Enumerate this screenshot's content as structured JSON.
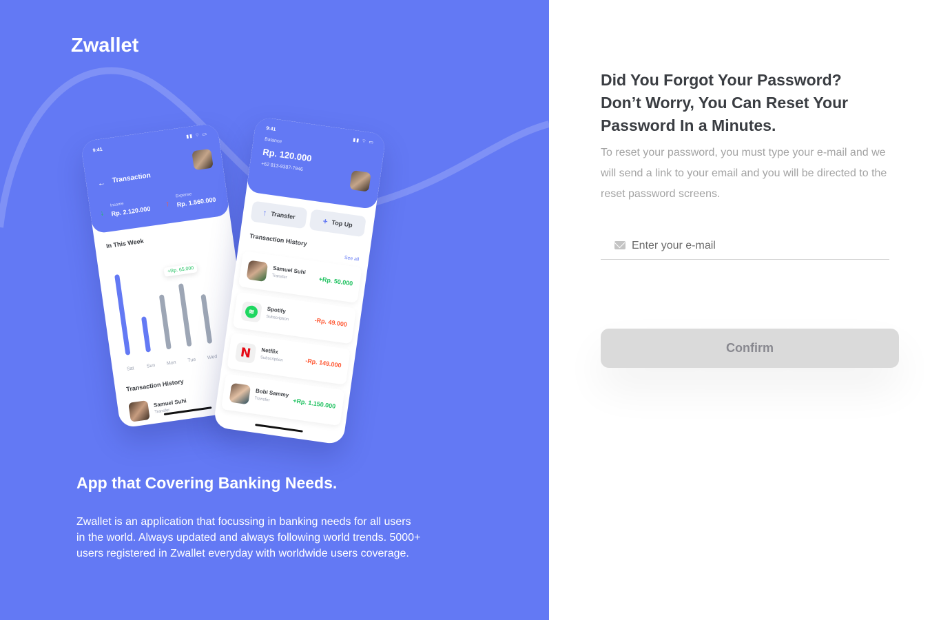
{
  "brand": "Zwallet",
  "colors": {
    "primary": "#6379f4",
    "income": "#1ec15f",
    "expense": "#ff5b37",
    "button_disabled": "#dadada"
  },
  "promo": {
    "tagline": "App that Covering Banking Needs.",
    "description": "Zwallet is an application that focussing in banking needs for all users in the world. Always updated and always following world trends. 5000+ users registered in Zwallet everyday with worldwide users coverage."
  },
  "phone_left": {
    "time": "9:41",
    "status_icons": "▮▮ ⌔ ▭",
    "title": "Transaction",
    "income_label": "Income",
    "income_value": "Rp. 2.120.000",
    "expense_label": "Expense",
    "expense_value": "Rp. 1.560.000",
    "week_title": "In This Week",
    "tooltip": "+Rp. 65.000",
    "days": [
      "Sat",
      "Sun",
      "Mon",
      "Tue",
      "Wed"
    ],
    "history_title": "Transaction History",
    "row_name": "Samuel Suhi",
    "row_sub": "Transfer"
  },
  "phone_right": {
    "time": "9:41",
    "status_icons": "▮▮ ⌔ ▭",
    "balance_label": "Balance",
    "balance_value": "Rp. 120.000",
    "phone_number": "+62 813-9387-7946",
    "transfer_label": "Transfer",
    "topup_label": "Top Up",
    "history_title": "Transaction History",
    "see_all": "See all",
    "transactions": [
      {
        "name": "Samuel Suhi",
        "type": "Transfer",
        "amount": "+Rp. 50.000"
      },
      {
        "name": "Spotify",
        "type": "Subscription",
        "amount": "-Rp. 49.000"
      },
      {
        "name": "Netflix",
        "type": "Subscription",
        "amount": "-Rp. 149.000"
      },
      {
        "name": "Bobi Sammy",
        "type": "Transfer",
        "amount": "+Rp. 1.150.000"
      }
    ]
  },
  "form": {
    "title": "Did You Forgot Your Password? Don’t Worry, You Can Reset Your Password In a Minutes.",
    "subtitle": "To reset your password, you must type your e-mail and we will send a link to your email and you will be directed to the reset password screens.",
    "email_placeholder": "Enter your e-mail",
    "email_value": "",
    "confirm_label": "Confirm"
  }
}
